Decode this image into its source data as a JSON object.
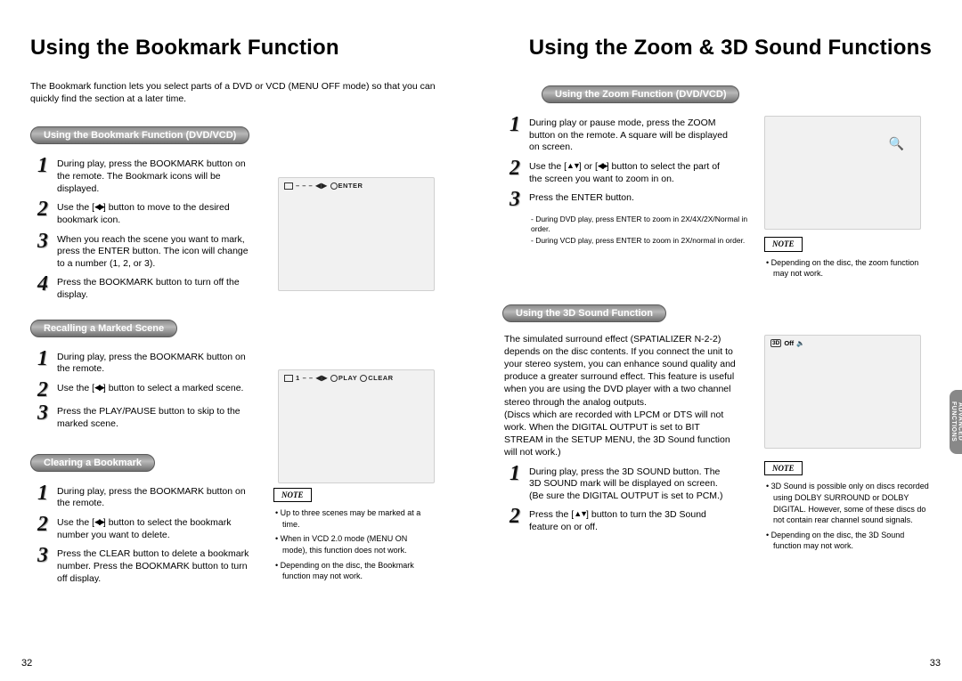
{
  "left": {
    "title": "Using the Bookmark Function",
    "intro": "The Bookmark function lets you select parts of a DVD or VCD (MENU OFF mode) so that you can quickly find the section at a later time.",
    "sec1": {
      "heading": "Using the Bookmark Function (DVD/VCD)",
      "s1": "During play, press the BOOKMARK button on the remote. The Bookmark icons will be displayed.",
      "s2a": "Use the [",
      "s2b": "] button to move to the desired bookmark icon.",
      "s3": "When you reach the scene you want to mark, press the ENTER button. The icon will change to a number (1, 2, or 3).",
      "s4": "Press the BOOKMARK button to turn off the display."
    },
    "sec2": {
      "heading": "Recalling a Marked Scene",
      "s1": "During play, press the BOOKMARK button on the remote.",
      "s2a": "Use the [",
      "s2b": "] button to select a marked scene.",
      "s3": "Press the PLAY/PAUSE button to skip to the marked scene."
    },
    "sec3": {
      "heading": "Clearing a Bookmark",
      "s1": "During play, press the BOOKMARK button on the remote.",
      "s2a": "Use the [",
      "s2b": "] button to select the bookmark number you want to delete.",
      "s3": "Press the CLEAR button to delete a bookmark number. Press the BOOKMARK button to turn off display."
    },
    "note": {
      "hdr": "NOTE",
      "n1": "Up to three scenes may be marked at a time.",
      "n2": "When in VCD 2.0 mode (MENU ON mode), this function does not work.",
      "n3": "Depending on the disc, the Bookmark function may not work."
    },
    "osd1": {
      "dashes": "–  –  –",
      "arrows": "◀▶",
      "enter": "ENTER"
    },
    "osd2": {
      "one": "1",
      "dashes": "–  –",
      "arrows": "◀▶",
      "play": "PLAY",
      "clear": "CLEAR"
    },
    "pgnum": "32"
  },
  "right": {
    "title": "Using the Zoom & 3D Sound Functions",
    "secZoom": {
      "heading": "Using the Zoom Function (DVD/VCD)",
      "s1": "During play or pause mode, press the ZOOM button on the remote. A square will be displayed on screen.",
      "s2a": "Use the [",
      "s2mid": "] or [",
      "s2b": "] button to select the part of the screen you want to zoom in on.",
      "s3": "Press the ENTER button.",
      "sub1": "- During DVD play, press ENTER to zoom in 2X/4X/2X/Normal in order.",
      "sub2": "- During VCD play, press ENTER to zoom in 2X/normal in order."
    },
    "noteZoom": {
      "hdr": "NOTE",
      "n1": "Depending on the disc, the zoom function may not work."
    },
    "sec3d": {
      "heading": "Using the 3D Sound Function",
      "para": "The simulated surround effect (SPATIALIZER N-2-2) depends on the disc contents. If you connect the unit to your stereo system, you can enhance sound quality and produce a greater surround effect. This feature is useful when you are using the DVD player with a two channel stereo through the analog outputs.\n(Discs which are recorded with LPCM or DTS will not work. When the DIGITAL OUTPUT is set to BIT STREAM in the SETUP MENU, the 3D Sound function will not work.)",
      "s1": "During play, press the 3D SOUND button. The 3D SOUND mark will be displayed on screen. (Be sure the DIGITAL OUTPUT is set to PCM.)",
      "s2a": "Press the [",
      "s2b": "] button to turn the 3D Sound feature on or off."
    },
    "note3d": {
      "hdr": "NOTE",
      "n1": "3D Sound is possible only on discs recorded using DOLBY SURROUND or DOLBY DIGITAL. However, some of these discs do not contain rear channel sound signals.",
      "n2": "Depending on the disc, the 3D Sound function may not work."
    },
    "osd3d": {
      "label": "3D",
      "off": "Off"
    },
    "tab": "ADVANCED FUNCTIONS",
    "pgnum": "33"
  }
}
